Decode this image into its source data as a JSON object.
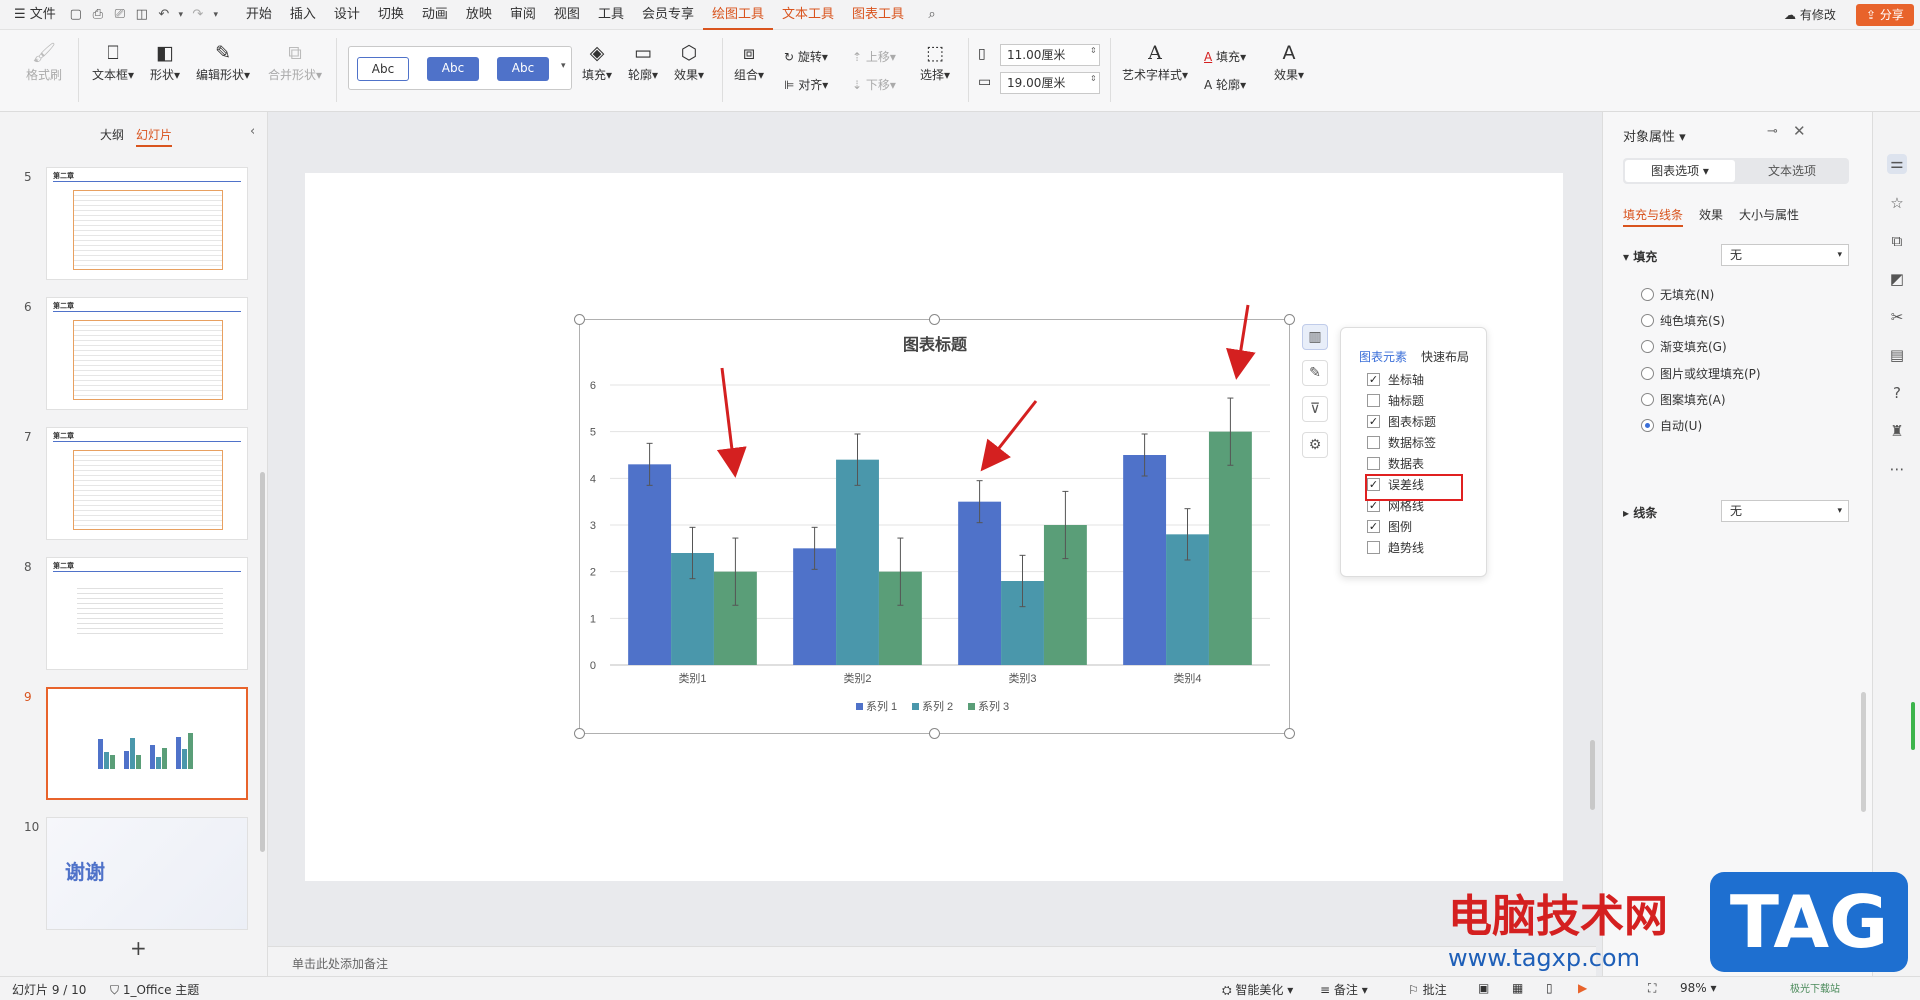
{
  "menubar": {
    "file": "文件",
    "tabs": [
      "开始",
      "插入",
      "设计",
      "切换",
      "动画",
      "放映",
      "审阅",
      "视图",
      "工具",
      "会员专享",
      "绘图工具",
      "文本工具",
      "图表工具"
    ],
    "modify_status": "有修改",
    "share": "分享"
  },
  "ribbon": {
    "format_painter": "格式刷",
    "textbox": "文本框",
    "shape": "形状",
    "edit_shape": "编辑形状",
    "merge_shape": "合并形状",
    "style_samples": [
      "Abc",
      "Abc",
      "Abc"
    ],
    "fill": "填充",
    "outline": "轮廓",
    "effect": "效果",
    "group": "组合",
    "rotate": "旋转",
    "align": "对齐",
    "bring_up": "上移",
    "send_down": "下移",
    "select": "选择",
    "height": "11.00厘米",
    "width": "19.00厘米",
    "art_style": "艺术字样式",
    "text_fill": "填充",
    "text_outline": "轮廓",
    "text_effect": "效果"
  },
  "leftpane": {
    "tab_outline": "大纲",
    "tab_slides": "幻灯片",
    "slides": [
      {
        "num": "5",
        "title": "第二章"
      },
      {
        "num": "6",
        "title": "第二章"
      },
      {
        "num": "7",
        "title": "第二章"
      },
      {
        "num": "8",
        "title": "第二章"
      },
      {
        "num": "9",
        "title": ""
      },
      {
        "num": "10",
        "title": "谢谢"
      }
    ],
    "add": "+"
  },
  "chart_data": {
    "type": "bar",
    "title": "图表标题",
    "categories": [
      "类别1",
      "类别2",
      "类别3",
      "类别4"
    ],
    "series": [
      {
        "name": "系列 1",
        "values": [
          4.3,
          2.5,
          3.5,
          4.5
        ],
        "color": "#4f72c9"
      },
      {
        "name": "系列 2",
        "values": [
          2.4,
          4.4,
          1.8,
          2.8
        ],
        "color": "#4a97ab"
      },
      {
        "name": "系列 3",
        "values": [
          2.0,
          2.0,
          3.0,
          5.0
        ],
        "color": "#5a9e78"
      }
    ],
    "error_bars": true,
    "ylim": [
      0,
      6
    ],
    "yticks": [
      "0",
      "1",
      "2",
      "3",
      "4",
      "5",
      "6"
    ],
    "grid": true,
    "legend": "bottom"
  },
  "chart_popup": {
    "tab_elements": "图表元素",
    "tab_layout": "快速布局",
    "items": [
      {
        "label": "坐标轴",
        "checked": true
      },
      {
        "label": "轴标题",
        "checked": false
      },
      {
        "label": "图表标题",
        "checked": true
      },
      {
        "label": "数据标签",
        "checked": false
      },
      {
        "label": "数据表",
        "checked": false
      },
      {
        "label": "误差线",
        "checked": true
      },
      {
        "label": "网格线",
        "checked": true
      },
      {
        "label": "图例",
        "checked": true
      },
      {
        "label": "趋势线",
        "checked": false
      }
    ]
  },
  "notes": {
    "placeholder": "单击此处添加备注"
  },
  "rightpane": {
    "title": "对象属性",
    "tab_chart": "图表选项",
    "tab_text": "文本选项",
    "sub_fill_line": "填充与线条",
    "sub_effect": "效果",
    "sub_size": "大小与属性",
    "fill_label": "填充",
    "fill_value": "无",
    "fill_options": [
      "无填充(N)",
      "纯色填充(S)",
      "渐变填充(G)",
      "图片或纹理填充(P)",
      "图案填充(A)",
      "自动(U)"
    ],
    "fill_selected": "自动(U)",
    "line_label": "线条",
    "line_value": "无"
  },
  "statusbar": {
    "slide_pos": "幻灯片 9 / 10",
    "theme": "1_Office 主题",
    "beautify": "智能美化",
    "notes": "备注",
    "comments": "批注",
    "zoom": "98%"
  },
  "watermark": {
    "text": "电脑技术网",
    "url": "www.tagxp.com",
    "logo": "TAG",
    "small": "极光下载站"
  },
  "colors": {
    "accent": "#d9541e",
    "blue": "#3b6fd8",
    "red_box": "#e02020",
    "arrow": "#d42020"
  }
}
